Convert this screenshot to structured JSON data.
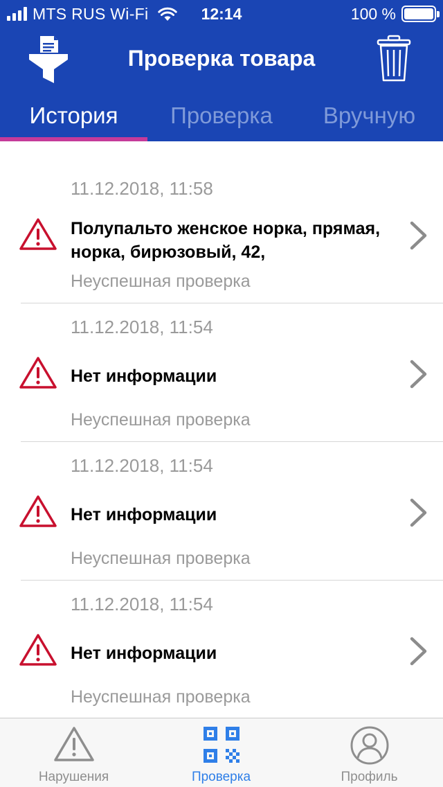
{
  "status_bar": {
    "carrier": "MTS RUS Wi-Fi",
    "time": "12:14",
    "battery_percent": "100 %",
    "battery_level": 1.0
  },
  "nav": {
    "title": "Проверка товара",
    "left_icon": "filter-document-icon",
    "right_icon": "trash-icon"
  },
  "tabs": [
    {
      "label": "История",
      "active": true
    },
    {
      "label": "Проверка",
      "active": false
    },
    {
      "label": "Вручную",
      "active": false
    }
  ],
  "history": [
    {
      "date": "11.12.2018, 11:58",
      "title": "Полупальто женское норка, прямая, норка, бирюзовый, 42,",
      "status": "Неуспешная проверка"
    },
    {
      "date": "11.12.2018, 11:54",
      "title": "Нет информации",
      "status": "Неуспешная проверка"
    },
    {
      "date": "11.12.2018, 11:54",
      "title": "Нет информации",
      "status": "Неуспешная проверка"
    },
    {
      "date": "11.12.2018, 11:54",
      "title": "Нет информации",
      "status": "Неуспешная проверка"
    }
  ],
  "tabbar": [
    {
      "label": "Нарушения",
      "icon": "warning-icon",
      "active": false
    },
    {
      "label": "Проверка",
      "icon": "qr-code-icon",
      "active": true
    },
    {
      "label": "Профиль",
      "icon": "profile-icon",
      "active": false
    }
  ],
  "colors": {
    "header": "#1a45b4",
    "tab_indicator": "#c53a9a",
    "warning": "#c8102e",
    "tabbar_active": "#2f7fe8",
    "muted": "#9a9a9a"
  }
}
